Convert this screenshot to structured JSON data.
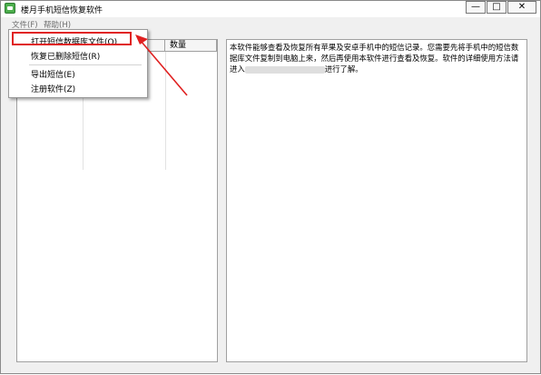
{
  "window": {
    "title": "楼月手机短信恢复软件",
    "controls": {
      "minimize": "—",
      "maximize": "□",
      "close": "✕"
    }
  },
  "menubar": {
    "file": "文件(F)",
    "help": "帮助(H)"
  },
  "file_menu": {
    "items": [
      {
        "label": "打开短信数据库文件(O)",
        "highlighted": true
      },
      {
        "label": "恢复已删除短信(R)"
      },
      {
        "label": "导出短信(E)"
      },
      {
        "label": "注册软件(Z)"
      }
    ]
  },
  "left_table": {
    "columns": [
      "",
      "数量"
    ]
  },
  "right_pane": {
    "text_part1": "本软件能够查看及恢复所有苹果及安卓手机中的短信记录。您需要先将手机中的短信数据库文件复制到电脑上来，然后再使用本软件进行查看及恢复。软件的详细使用方法请进入",
    "text_part2": "进行了解。"
  },
  "annotation": {
    "color": "#e02020"
  }
}
